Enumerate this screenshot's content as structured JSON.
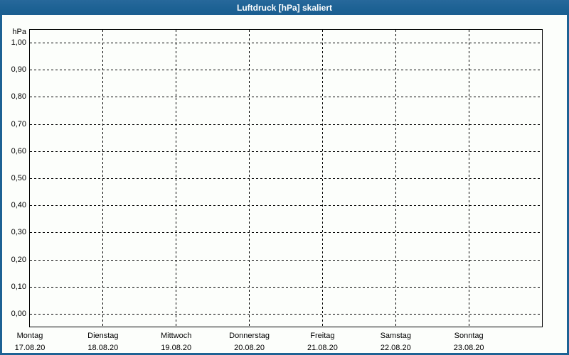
{
  "window": {
    "title": "Luftdruck [hPa] skaliert"
  },
  "colors": {
    "frame_blue": "#1d6294",
    "title_text": "#ffffff",
    "panel_bg": "#fcfefb",
    "grid_and_text": "#000000"
  },
  "chart_data": {
    "type": "line",
    "title": "Luftdruck [hPa] skaliert",
    "ylabel": "hPa",
    "xlabel": "",
    "grid": "dashed",
    "legend": "none",
    "y_axis": {
      "min": 0.0,
      "max": 1.0,
      "step": 0.1,
      "tick_labels_top_to_bottom": [
        "1,00",
        "0,90",
        "0,80",
        "0,70",
        "0,60",
        "0,50",
        "0,40",
        "0,30",
        "0,20",
        "0,10",
        "0,00"
      ]
    },
    "x_axis": {
      "days": [
        {
          "day": "Montag",
          "date": "17.08.20"
        },
        {
          "day": "Dienstag",
          "date": "18.08.20"
        },
        {
          "day": "Mittwoch",
          "date": "19.08.20"
        },
        {
          "day": "Donnerstag",
          "date": "20.08.20"
        },
        {
          "day": "Freitag",
          "date": "21.08.20"
        },
        {
          "day": "Samstag",
          "date": "22.08.20"
        },
        {
          "day": "Sonntag",
          "date": "23.08.20"
        }
      ]
    },
    "series": []
  }
}
